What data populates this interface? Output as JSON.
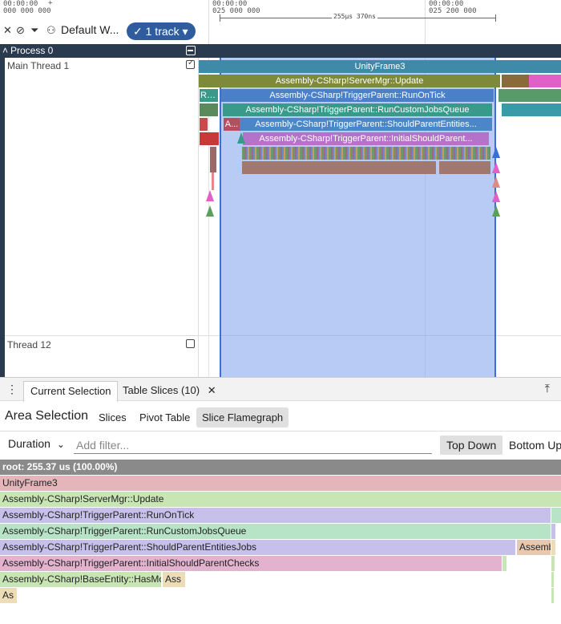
{
  "timeline": {
    "ticks": [
      {
        "time": "00:00:00",
        "ns": "000 000 000"
      },
      {
        "time": "00:00:00",
        "ns": "025 000 000"
      },
      {
        "time": "00:00:00",
        "ns": "025 200 000"
      }
    ],
    "plus_sign": "+",
    "span_label": "255µs 370ns"
  },
  "toolbar": {
    "workspace_name": "Default W...",
    "track_filter_label": "1 track"
  },
  "process": {
    "title": "Process 0"
  },
  "threads": [
    {
      "label": "Main Thread 1",
      "checked": true
    },
    {
      "label": "Thread 12",
      "checked": false
    }
  ],
  "slices": {
    "unity_frame": "UnityFrame3",
    "server_update": "Assembly-CSharp!ServerMgr::Update",
    "run_on_tick": "Assembly-CSharp!TriggerParent::RunOnTick",
    "run_on_tick_short": "Ru...",
    "run_custom_jobs": "Assembly-CSharp!TriggerParent::RunCustomJobsQueue",
    "should_parent": "Assembly-CSharp!TriggerParent::ShouldParentEntities...",
    "should_parent_short": "A...",
    "initial_should": "Assembly-CSharp!TriggerParent::InitialShouldParent..."
  },
  "colors": {
    "unity_frame": "#3f8aa8",
    "server_update": "#7e8a3a",
    "run_on_tick": "#4a7fc9",
    "run_custom_jobs": "#3a9a8a",
    "should_parent": "#4a86c8",
    "initial_should": "#b572c9",
    "selection": "#3a6fd4"
  },
  "panel": {
    "tabs": [
      {
        "label": "Current Selection",
        "active": true
      },
      {
        "label": "Table Slices (10)",
        "active": false,
        "closable": true
      }
    ],
    "area_title": "Area Selection",
    "subtabs": [
      "Slices",
      "Pivot Table",
      "Slice Flamegraph"
    ],
    "active_subtab": "Slice Flamegraph",
    "metric": "Duration",
    "filter_placeholder": "Add filter...",
    "modes": [
      "Top Down",
      "Bottom Up"
    ],
    "active_mode": "Top Down"
  },
  "flamegraph": {
    "root": "root: 255.37 us (100.00%)",
    "rows": [
      {
        "label": "UnityFrame3",
        "color": "#e4b6bb"
      },
      {
        "label": "Assembly-CSharp!ServerMgr::Update",
        "color": "#c8e6b4"
      },
      {
        "label": "Assembly-CSharp!TriggerParent::RunOnTick",
        "color": "#c6c0ea"
      },
      {
        "label": "Assembly-CSharp!TriggerParent::RunCustomJobsQueue",
        "color": "#b7e4c6"
      },
      {
        "label": "Assembly-CSharp!TriggerParent::ShouldParentEntitiesJobs",
        "color": "#c6c0ea",
        "extra": "Assemb",
        "extra_color": "#e8c9b0"
      },
      {
        "label": "Assembly-CSharp!TriggerParent::InitialShouldParentChecks",
        "color": "#e2b2cf"
      },
      {
        "label": "Assembly-CSharp!BaseEntity::HasMove",
        "color": "#c8e6b4",
        "extra": "Ass",
        "extra_color": "#ecdcb8"
      },
      {
        "label": "As",
        "color": "#ecdcb8"
      }
    ]
  }
}
